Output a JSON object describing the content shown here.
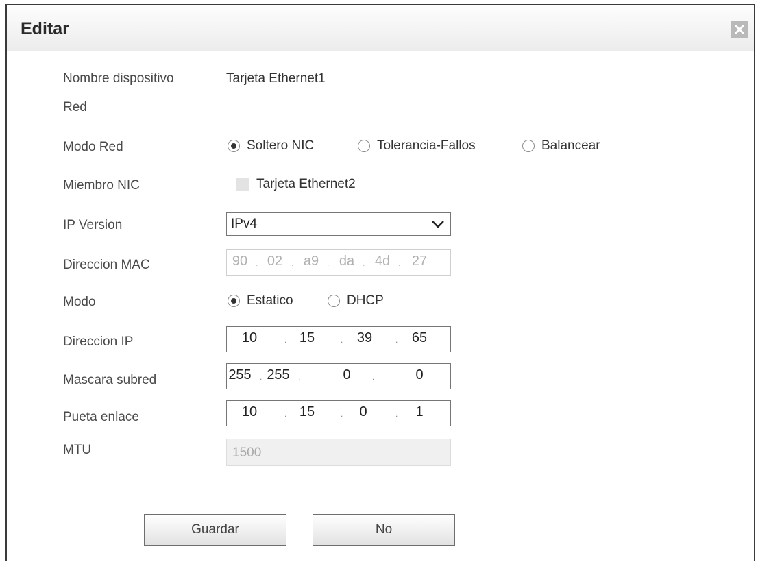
{
  "dialog": {
    "title": "Editar"
  },
  "fields": {
    "device_name": {
      "label_line1": "Nombre dispositivo",
      "label_line2": "Red",
      "value": "Tarjeta Ethernet1"
    },
    "network_mode": {
      "label": "Modo Red",
      "options": [
        "Soltero NIC",
        "Tolerancia-Fallos",
        "Balancear"
      ],
      "selected": "Soltero NIC"
    },
    "nic_member": {
      "label": "Miembro NIC",
      "checkbox_label": "Tarjeta Ethernet2",
      "checked": false
    },
    "ip_version": {
      "label": "IP Version",
      "value": "IPv4"
    },
    "mac": {
      "label": "Direccion MAC",
      "octets": [
        "90",
        "02",
        "a9",
        "da",
        "4d",
        "27"
      ]
    },
    "mode": {
      "label": "Modo",
      "options": [
        "Estatico",
        "DHCP"
      ],
      "selected": "Estatico"
    },
    "ip": {
      "label": "Direccion IP",
      "octets": [
        "10",
        "15",
        "39",
        "65"
      ]
    },
    "subnet": {
      "label": "Mascara subred",
      "octets": [
        "255",
        "255",
        "0",
        "0"
      ]
    },
    "gateway": {
      "label": "Pueta enlace",
      "octets": [
        "10",
        "15",
        "0",
        "1"
      ]
    },
    "mtu": {
      "label": "MTU",
      "placeholder": "1500"
    }
  },
  "buttons": {
    "save": "Guardar",
    "cancel": "No"
  }
}
